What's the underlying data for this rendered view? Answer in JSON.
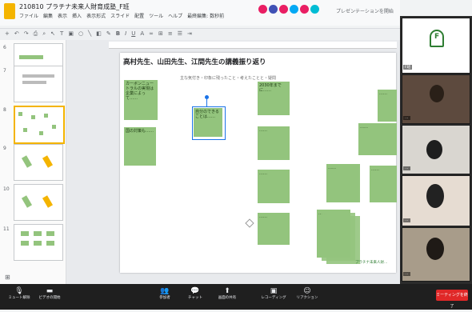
{
  "app": {
    "doc_title": "210810 プラチナ未来人財育成塾_F班",
    "menu": [
      "ファイル",
      "編集",
      "表示",
      "挿入",
      "表示形式",
      "スライド",
      "配置",
      "ツール",
      "ヘルプ",
      "最終編集: 数秒前"
    ],
    "present_label": "プレゼンテーションを開始"
  },
  "slide": {
    "title": "高村先生、山田先生、江間先生の講義振り返り",
    "subtitle": "主な気付き・印象に残ったこと・考えたことと・疑問",
    "notes": [
      {
        "text": "カーボンニュートラルの実現は企業によって……"
      },
      {
        "text": "国の対策も……"
      },
      {
        "text": "自分のできることは……"
      },
      {
        "text": "2030年までに……"
      },
      {
        "text": "……"
      },
      {
        "text": "……"
      },
      {
        "text": "……"
      },
      {
        "text": "……"
      },
      {
        "text": "……"
      },
      {
        "text": "……"
      },
      {
        "text": "……"
      },
      {
        "text": "……"
      }
    ],
    "brand_mark": "プラチナ未来人財…"
  },
  "video": {
    "participants": [
      {
        "name": "F班"
      },
      {
        "name": "…"
      },
      {
        "name": "…"
      },
      {
        "name": "…"
      },
      {
        "name": "…"
      }
    ]
  },
  "zoom_controls": {
    "buttons": [
      "ミュート解除",
      "ビデオの開始",
      "参加者",
      "チャット",
      "画面の共有",
      "レコーディング",
      "リアクション"
    ],
    "end_label": "ミーティングを終了"
  },
  "colors": {
    "note": "#93c47d",
    "selection": "#1a73e8",
    "slides_accent": "#f4b400",
    "end_red": "#e02828"
  }
}
